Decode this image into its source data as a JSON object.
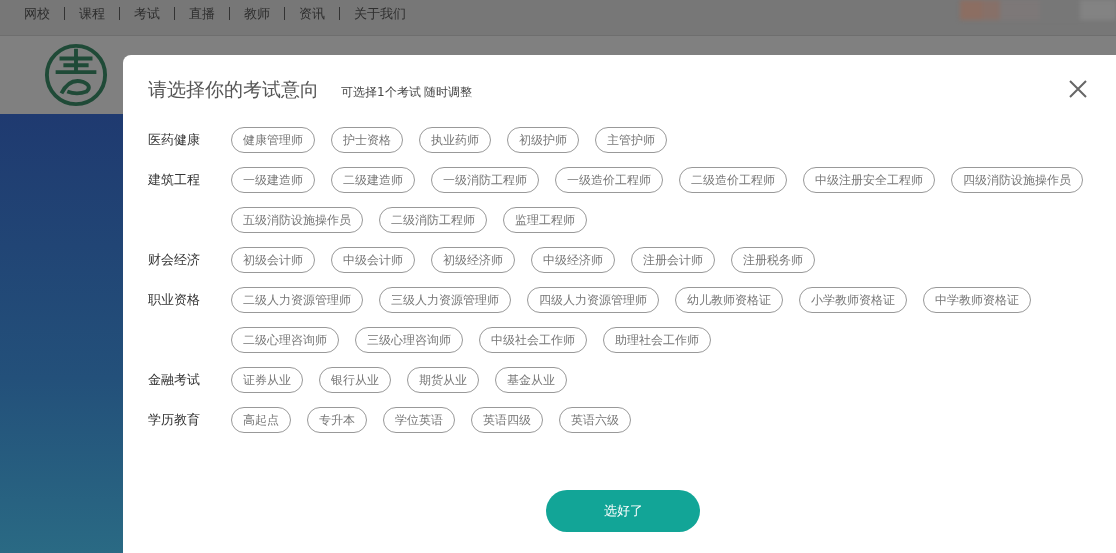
{
  "nav": [
    "网校",
    "课程",
    "考试",
    "直播",
    "教师",
    "资讯",
    "关于我们"
  ],
  "dialog": {
    "title": "请选择你的考试意向",
    "subtitle": "可选择1个考试 随时调整",
    "groups": [
      {
        "name": "医药健康",
        "tags": [
          {
            "label": "健康管理师",
            "selected": false
          },
          {
            "label": "护士资格",
            "selected": false
          },
          {
            "label": "执业药师",
            "selected": false
          },
          {
            "label": "初级护师",
            "selected": false
          },
          {
            "label": "主管护师",
            "selected": false
          }
        ]
      },
      {
        "name": "建筑工程",
        "tags": [
          {
            "label": "一级建造师",
            "selected": false
          },
          {
            "label": "二级建造师",
            "selected": false
          },
          {
            "label": "一级消防工程师",
            "selected": false
          },
          {
            "label": "一级造价工程师",
            "selected": false
          },
          {
            "label": "二级造价工程师",
            "selected": false
          },
          {
            "label": "中级注册安全工程师",
            "selected": false
          },
          {
            "label": "四级消防设施操作员",
            "selected": false
          },
          {
            "label": "五级消防设施操作员",
            "selected": false
          },
          {
            "label": "二级消防工程师",
            "selected": false
          },
          {
            "label": "监理工程师",
            "selected": false
          }
        ]
      },
      {
        "name": "财会经济",
        "tags": [
          {
            "label": "初级会计师",
            "selected": false
          },
          {
            "label": "中级会计师",
            "selected": false
          },
          {
            "label": "初级经济师",
            "selected": false
          },
          {
            "label": "中级经济师",
            "selected": false
          },
          {
            "label": "注册会计师",
            "selected": false
          },
          {
            "label": "注册税务师",
            "selected": false
          }
        ]
      },
      {
        "name": "职业资格",
        "tags": [
          {
            "label": "二级人力资源管理师",
            "selected": false
          },
          {
            "label": "三级人力资源管理师",
            "selected": false
          },
          {
            "label": "四级人力资源管理师",
            "selected": false
          },
          {
            "label": "幼儿教师资格证",
            "selected": false
          },
          {
            "label": "小学教师资格证",
            "selected": false
          },
          {
            "label": "中学教师资格证",
            "selected": false
          },
          {
            "label": "二级心理咨询师",
            "selected": false
          },
          {
            "label": "三级心理咨询师",
            "selected": false
          },
          {
            "label": "中级社会工作师",
            "selected": false
          },
          {
            "label": "助理社会工作师",
            "selected": false
          }
        ]
      },
      {
        "name": "金融考试",
        "tags": [
          {
            "label": "证券从业",
            "selected": false
          },
          {
            "label": "银行从业",
            "selected": false
          },
          {
            "label": "期货从业",
            "selected": false
          },
          {
            "label": "基金从业",
            "selected": false
          }
        ]
      },
      {
        "name": "学历教育",
        "tags": [
          {
            "label": "高起点",
            "selected": false
          },
          {
            "label": "专升本",
            "selected": false
          },
          {
            "label": "学位英语",
            "selected": false
          },
          {
            "label": "英语四级",
            "selected": false
          },
          {
            "label": "英语六级",
            "selected": false
          }
        ]
      }
    ],
    "confirm": "选好了"
  }
}
